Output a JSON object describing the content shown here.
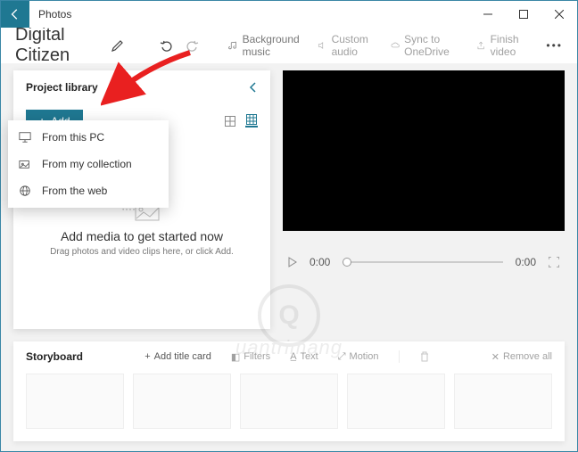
{
  "app": {
    "title": "Photos"
  },
  "project": {
    "name": "Digital Citizen"
  },
  "toolbar": {
    "bgmusic": "Background music",
    "custom_audio": "Custom audio",
    "sync": "Sync to OneDrive",
    "finish": "Finish video"
  },
  "library": {
    "title": "Project library",
    "add_label": "Add",
    "placeholder_title": "Add media to get started now",
    "placeholder_sub": "Drag photos and video clips here, or click Add."
  },
  "dropdown": {
    "from_pc": "From this PC",
    "from_collection": "From my collection",
    "from_web": "From the web"
  },
  "player": {
    "current": "0:00",
    "total": "0:00"
  },
  "storyboard": {
    "title": "Storyboard",
    "add_title_card": "Add title card",
    "filters": "Filters",
    "text": "Text",
    "motion": "Motion",
    "remove_all": "Remove all"
  },
  "watermark": {
    "letter": "Q",
    "text": "uantrimang"
  }
}
